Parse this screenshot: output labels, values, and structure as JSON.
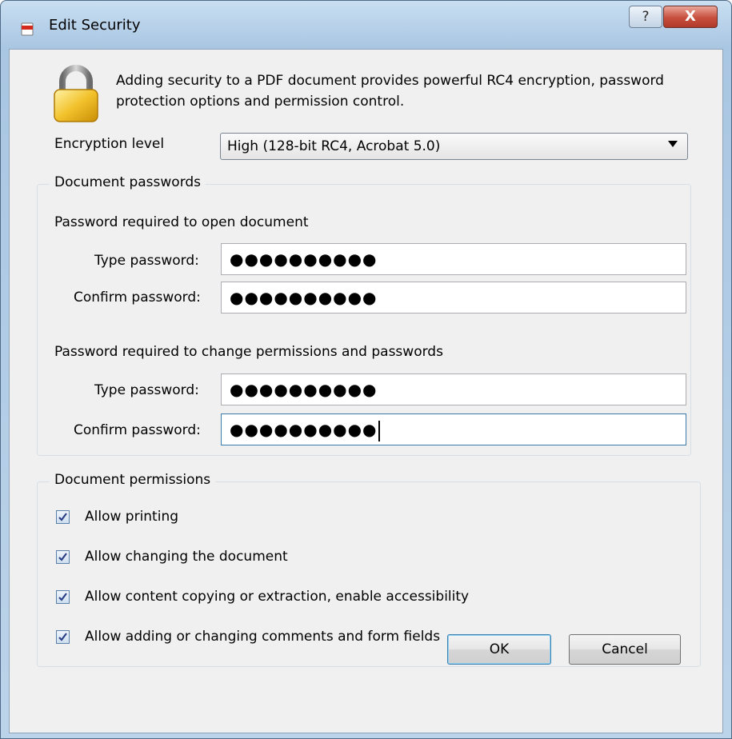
{
  "window": {
    "title": "Edit Security",
    "help_glyph": "?",
    "close_glyph": "X"
  },
  "intro": "Adding security to a PDF document provides powerful RC4 encryption, password protection options and permission control.",
  "encryption": {
    "label": "Encryption level",
    "selected": "High (128-bit RC4, Acrobat 5.0)"
  },
  "passwords": {
    "group_title": "Document passwords",
    "open": {
      "heading": "Password required to open document",
      "type_label": "Type password:",
      "type_value": "●●●●●●●●●●",
      "confirm_label": "Confirm password:",
      "confirm_value": "●●●●●●●●●●"
    },
    "perm": {
      "heading": "Password required to change permissions and passwords",
      "type_label": "Type password:",
      "type_value": "●●●●●●●●●●",
      "confirm_label": "Confirm password:",
      "confirm_value": "●●●●●●●●●●"
    }
  },
  "permissions": {
    "group_title": "Document permissions",
    "items": [
      {
        "label": "Allow printing",
        "checked": true
      },
      {
        "label": "Allow changing the document",
        "checked": true
      },
      {
        "label": "Allow content copying or extraction, enable accessibility",
        "checked": true
      },
      {
        "label": "Allow adding or changing comments and form fields",
        "checked": true
      }
    ]
  },
  "buttons": {
    "ok": "OK",
    "cancel": "Cancel"
  },
  "icons": {
    "app": "pdf-app-icon",
    "lock": "padlock-icon",
    "check": "checkmark-icon"
  },
  "colors": {
    "accent": "#3d7bad",
    "close": "#c84f3d",
    "face": "#f0f0f0"
  }
}
